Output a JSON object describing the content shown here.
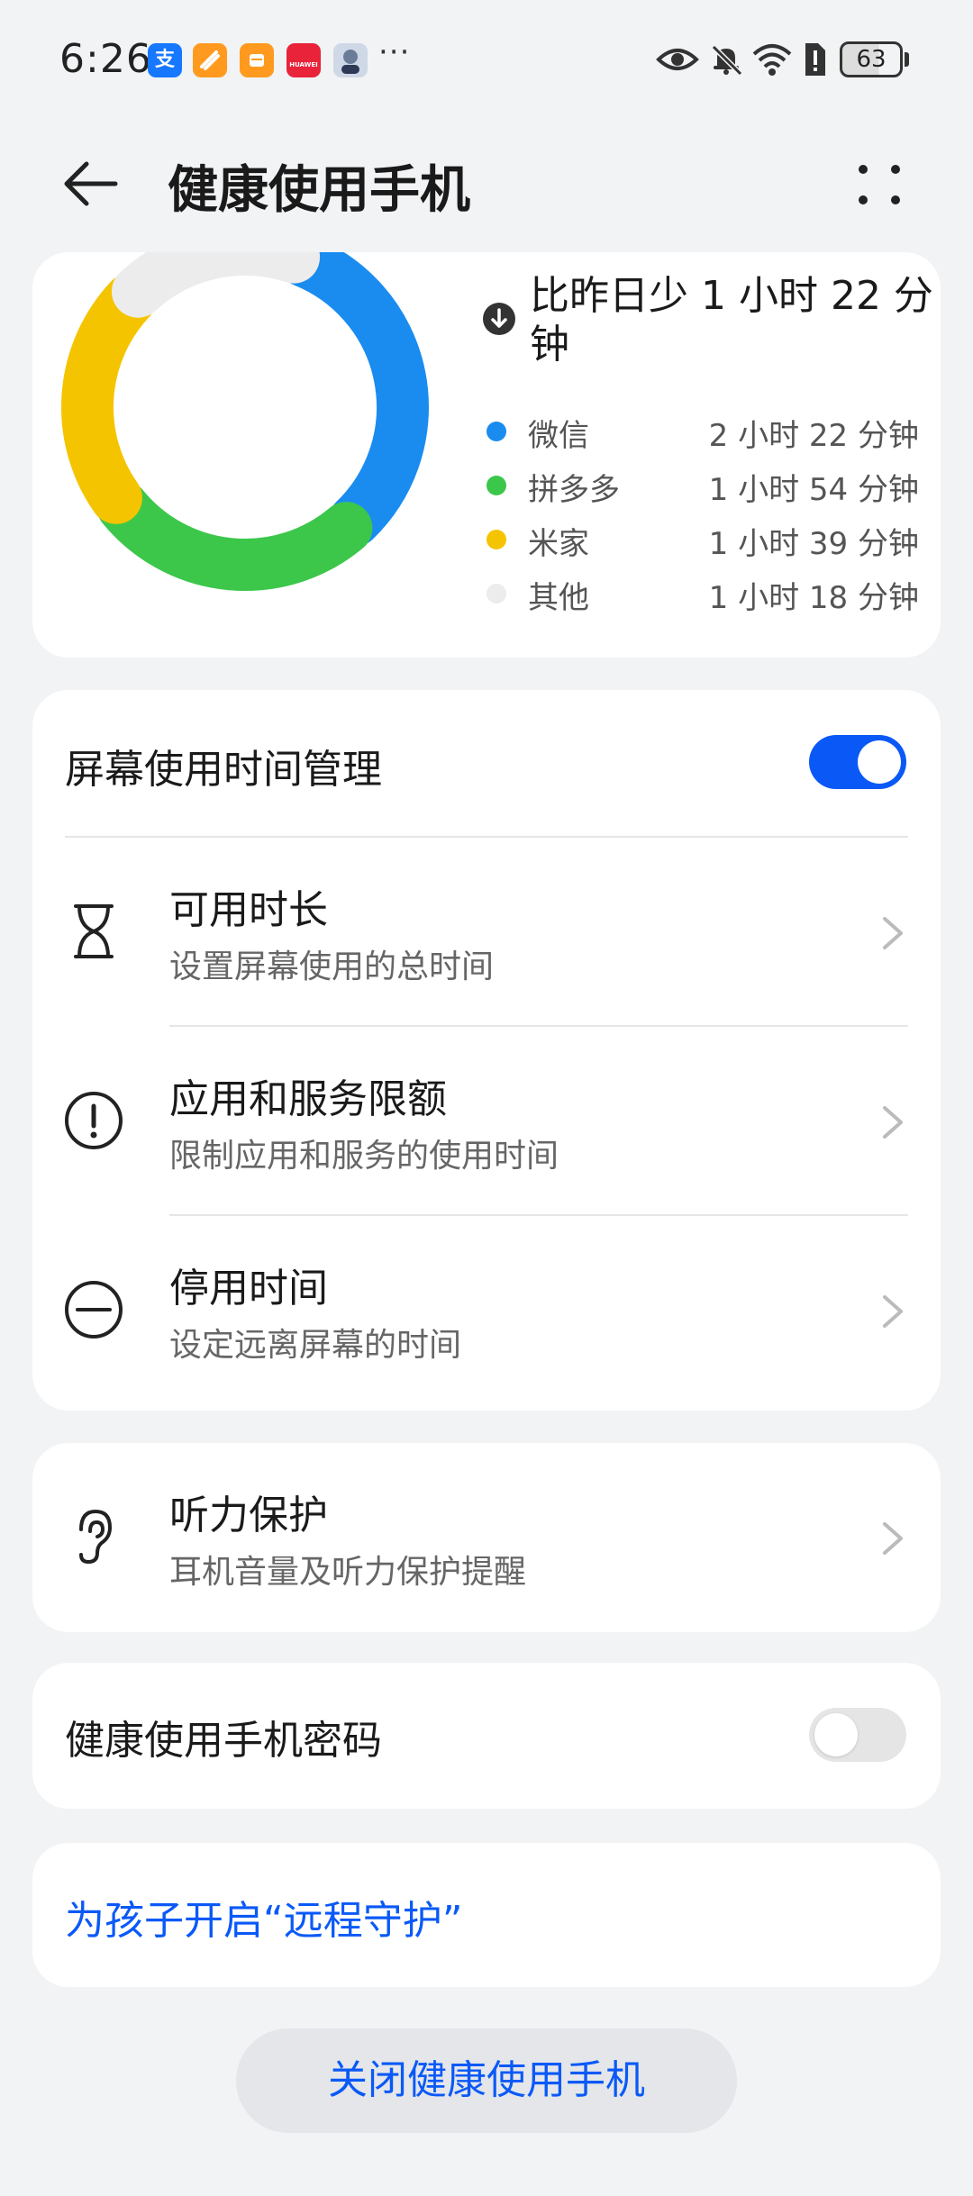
{
  "status_bar": {
    "time": "6:26",
    "notification_icons": [
      "alipay-icon",
      "taobao-icon",
      "orange-app-icon",
      "huawei-icon",
      "avatar-app-icon"
    ],
    "huawei_label": "HUAWEI",
    "alipay_glyph": "支",
    "more": "···",
    "battery": "63"
  },
  "header": {
    "title": "健康使用手机"
  },
  "usage": {
    "delta_text": "比昨日少 1 小时 22 分钟",
    "apps": [
      {
        "name": "微信",
        "time": "2 小时 22 分钟",
        "color": "#1a8cf0"
      },
      {
        "name": "拼多多",
        "time": "1 小时 54 分钟",
        "color": "#3cc74a"
      },
      {
        "name": "米家",
        "time": "1 小时 39 分钟",
        "color": "#f5c400"
      },
      {
        "name": "其他",
        "time": "1 小时 18 分钟",
        "color": "#ececec"
      }
    ]
  },
  "screen_time": {
    "label": "屏幕使用时间管理",
    "enabled": true,
    "items": [
      {
        "title": "可用时长",
        "subtitle": "设置屏幕使用的总时间",
        "icon": "hourglass-icon"
      },
      {
        "title": "应用和服务限额",
        "subtitle": "限制应用和服务的使用时间",
        "icon": "exclamation-circle-icon"
      },
      {
        "title": "停用时间",
        "subtitle": "设定远离屏幕的时间",
        "icon": "minus-circle-icon"
      }
    ]
  },
  "hearing": {
    "title": "听力保护",
    "subtitle": "耳机音量及听力保护提醒",
    "icon": "ear-icon"
  },
  "password": {
    "label": "健康使用手机密码",
    "enabled": false
  },
  "remote": {
    "label": "为孩子开启“远程守护”"
  },
  "footer": {
    "close_label": "关闭健康使用手机"
  },
  "colors": {
    "accent": "#0a59f7",
    "background": "#f1f3f5"
  }
}
